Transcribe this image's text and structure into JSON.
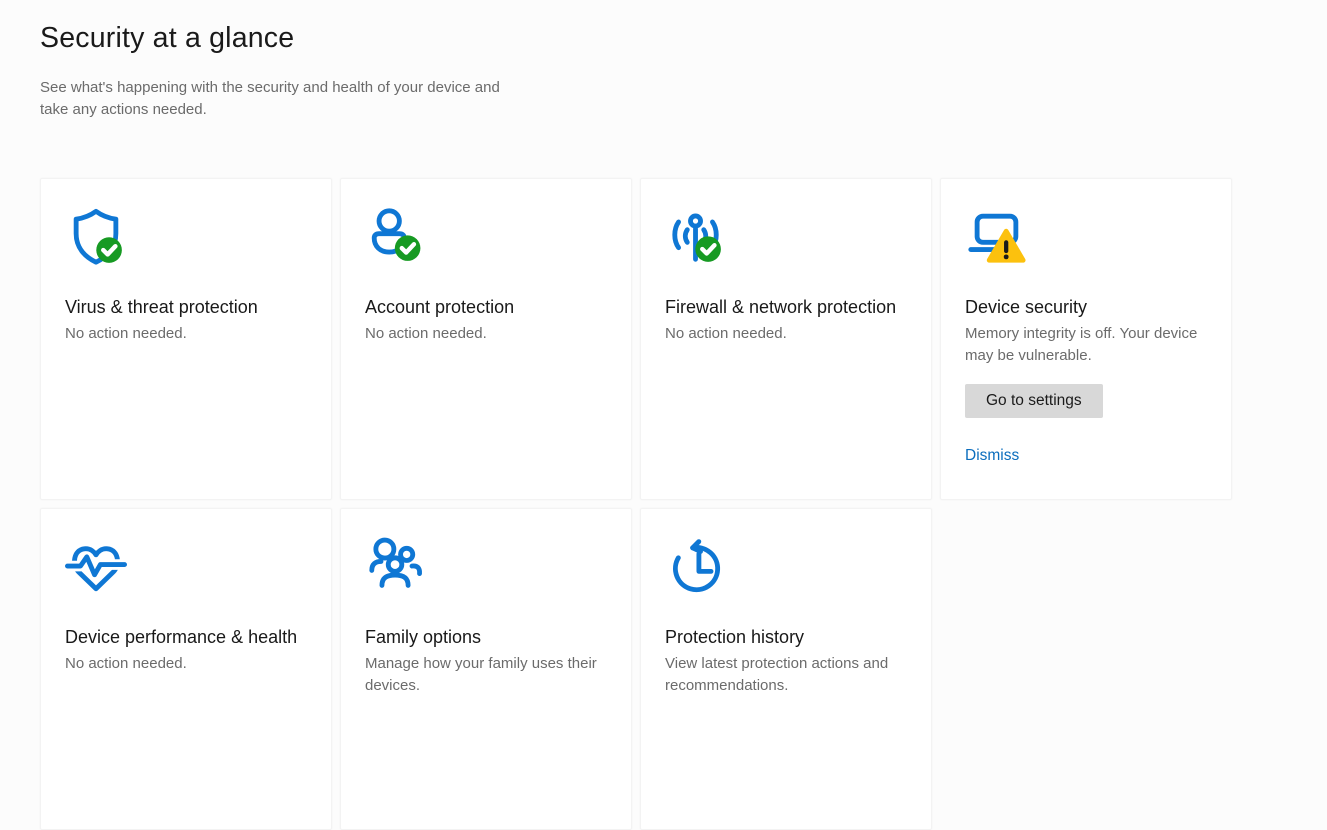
{
  "page": {
    "title": "Security at a glance",
    "subtitle": "See what's happening with the security and health of your device and take any actions needed."
  },
  "colors": {
    "icon_blue": "#0f77d4",
    "status_green": "#179a23",
    "warning_yellow": "#fcc10e",
    "link_blue": "#0b6dbd",
    "button_gray": "#d8d8d8"
  },
  "cards": [
    {
      "icon": "shield-icon",
      "badge": "check",
      "title": "Virus & threat protection",
      "description": "No action needed."
    },
    {
      "icon": "person-icon",
      "badge": "check",
      "title": "Account protection",
      "description": "No action needed."
    },
    {
      "icon": "antenna-icon",
      "badge": "check",
      "title": "Firewall & network protection",
      "description": "No action needed."
    },
    {
      "icon": "laptop-icon",
      "badge": "warning",
      "title": "Device security",
      "description": "Memory integrity is off. Your device may be vulnerable.",
      "button_label": "Go to settings",
      "link_label": "Dismiss"
    },
    {
      "icon": "heart-pulse-icon",
      "badge": "none",
      "title": "Device performance & health",
      "description": "No action needed."
    },
    {
      "icon": "family-icon",
      "badge": "none",
      "title": "Family options",
      "description": "Manage how your family uses their devices."
    },
    {
      "icon": "history-icon",
      "badge": "none",
      "title": "Protection history",
      "description": "View latest protection actions and recommendations."
    }
  ]
}
